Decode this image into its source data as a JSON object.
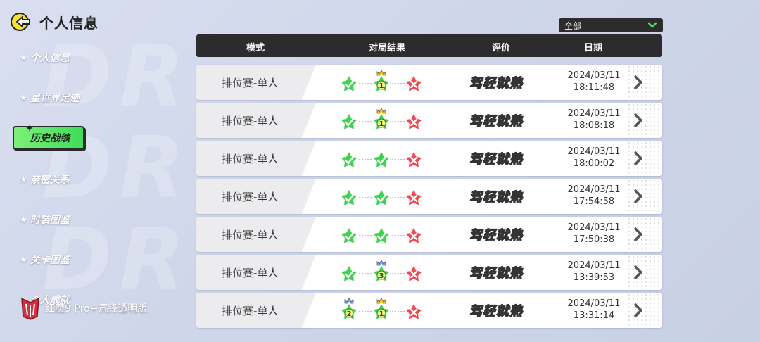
{
  "header": {
    "title": "个人信息",
    "back_icon": "back-arrow-icon"
  },
  "sidebar": {
    "items": [
      {
        "label": "个人信息",
        "active": false
      },
      {
        "label": "星世界足迹",
        "active": false
      },
      {
        "label": "历史战绩",
        "active": true
      },
      {
        "label": "亲密关系",
        "active": false
      },
      {
        "label": "时装图鉴",
        "active": false
      },
      {
        "label": "关卡图鉴",
        "active": false
      },
      {
        "label": "个人成就",
        "active": false
      }
    ]
  },
  "filter": {
    "selected": "全部"
  },
  "table": {
    "headers": {
      "mode": "模式",
      "result": "对局结果",
      "rating": "评价",
      "date": "日期"
    },
    "rows": [
      {
        "mode": "排位赛-单人",
        "stages": [
          "check",
          "1",
          "x"
        ],
        "crowns": [
          "",
          "gold",
          ""
        ],
        "rating": "驾轻就熟",
        "date": "2024/03/11",
        "time": "18:11:48"
      },
      {
        "mode": "排位赛-单人",
        "stages": [
          "check",
          "1",
          "x"
        ],
        "crowns": [
          "",
          "gold",
          ""
        ],
        "rating": "驾轻就熟",
        "date": "2024/03/11",
        "time": "18:08:18"
      },
      {
        "mode": "排位赛-单人",
        "stages": [
          "check",
          "check",
          "x"
        ],
        "crowns": [
          "",
          "",
          ""
        ],
        "rating": "驾轻就熟",
        "date": "2024/03/11",
        "time": "18:00:02"
      },
      {
        "mode": "排位赛-单人",
        "stages": [
          "check",
          "check",
          "x"
        ],
        "crowns": [
          "",
          "",
          ""
        ],
        "rating": "驾轻就熟",
        "date": "2024/03/11",
        "time": "17:54:58"
      },
      {
        "mode": "排位赛-单人",
        "stages": [
          "check",
          "check",
          "x"
        ],
        "crowns": [
          "",
          "",
          ""
        ],
        "rating": "驾轻就熟",
        "date": "2024/03/11",
        "time": "17:50:38"
      },
      {
        "mode": "排位赛-单人",
        "stages": [
          "check",
          "3",
          "x"
        ],
        "crowns": [
          "",
          "blue",
          ""
        ],
        "rating": "驾轻就熟",
        "date": "2024/03/11",
        "time": "13:39:53"
      },
      {
        "mode": "排位赛-单人",
        "stages": [
          "2",
          "1",
          "x"
        ],
        "crowns": [
          "blue",
          "gold",
          ""
        ],
        "rating": "驾轻就熟",
        "date": "2024/03/11",
        "time": "13:31:14"
      }
    ]
  },
  "watermark": {
    "text": "红魔9 Pro+氘锋透明版",
    "icon": "red-magic-logo-icon"
  },
  "colors": {
    "green_star": "#3fd24f",
    "red_star": "#ef4b55",
    "header_bg": "#2c2c2e",
    "active_tab": "#4be05e"
  }
}
